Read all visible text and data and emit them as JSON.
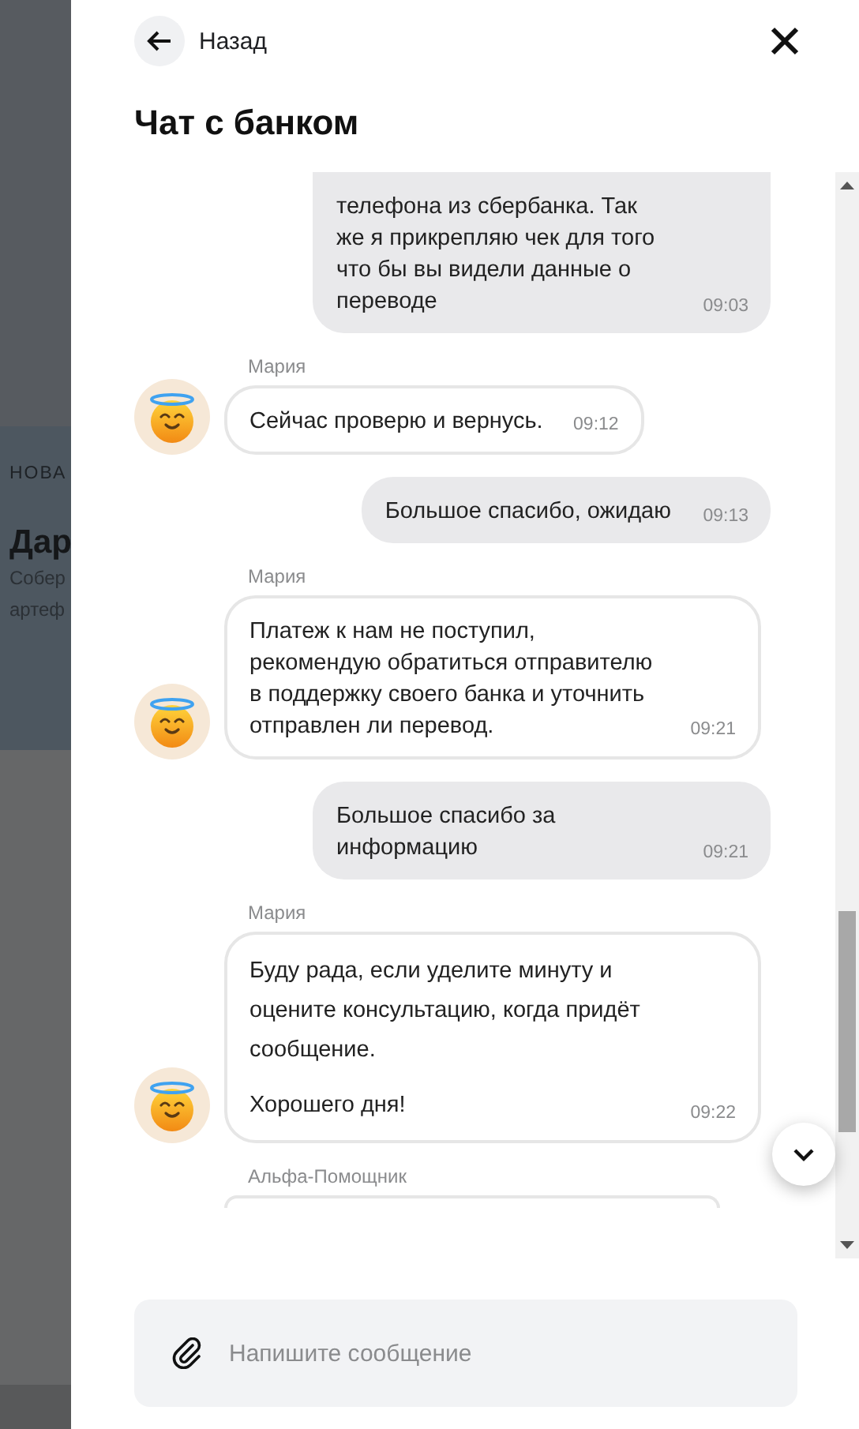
{
  "background_page": {
    "section_label": "НОВА",
    "heading": "Дар",
    "description_lines": [
      "Собер",
      "артеф"
    ]
  },
  "header": {
    "back_label": "Назад",
    "title": "Чат с банком"
  },
  "messages": [
    {
      "kind": "outgoing",
      "paragraphs": [
        "телефона из сбербанка. Так же я прикрепляю чек для того что бы вы видели данные о переводе"
      ],
      "time": "09:03",
      "cut_top": true
    },
    {
      "kind": "incoming",
      "sender": "Мария",
      "paragraphs": [
        "Сейчас проверю и вернусь."
      ],
      "time": "09:12"
    },
    {
      "kind": "outgoing",
      "paragraphs": [
        "Большое спасибо, ожидаю"
      ],
      "time": "09:13"
    },
    {
      "kind": "incoming",
      "sender": "Мария",
      "paragraphs": [
        "Платеж к нам не поступил, рекомендую обратиться отправителю в поддержку своего банка и уточнить отправлен ли перевод."
      ],
      "time": "09:21"
    },
    {
      "kind": "outgoing",
      "paragraphs": [
        "Большое спасибо за информацию"
      ],
      "time": "09:21"
    },
    {
      "kind": "incoming",
      "sender": "Мария",
      "paragraphs": [
        "Буду рада, если уделите минуту и оцените консультацию, когда придёт сообщение.",
        "Хорошего дня!"
      ],
      "time": "09:22"
    },
    {
      "kind": "incoming_cut",
      "sender": "Альфа-Помощник"
    }
  ],
  "composer": {
    "placeholder": "Напишите сообщение"
  }
}
